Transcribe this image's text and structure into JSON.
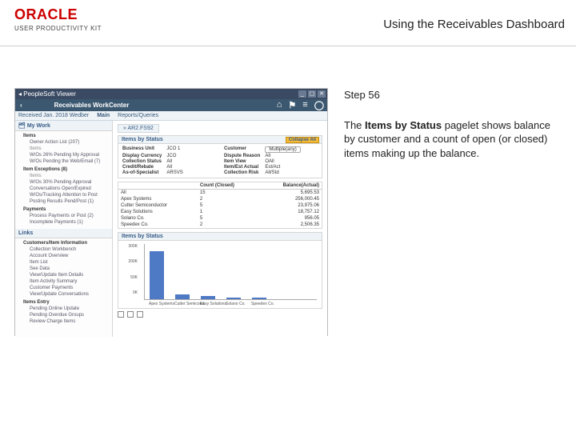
{
  "header": {
    "brand": "ORACLE",
    "brand_sub": "USER PRODUCTIVITY KIT",
    "lesson_title": "Using the Receivables Dashboard"
  },
  "instruction": {
    "step_label": "Step 56",
    "text_pre": "The ",
    "text_bold": "Items by Status",
    "text_post": " pagelet shows balance by customer and a count of open (or closed) items making up the balance."
  },
  "titlebar": {
    "caption": "◂ PeopleSoft Viewer"
  },
  "appbar": {
    "back": "‹",
    "title": "Receivables WorkCenter",
    "icons": [
      "⌂",
      "⚑",
      "≡",
      "◯"
    ]
  },
  "navrow": {
    "left": "Received Jan. 2018 Wedber",
    "items": [
      "Main",
      "Reports/Queries"
    ]
  },
  "leftnav": {
    "mywork_hdr": "My Work",
    "items_hdr": "Items",
    "items": [
      "Owner Action List (207)",
      "Items",
      "W/Os 26% Pending My Approval",
      "W/Os Pending the Web/Email (7)"
    ],
    "exceptions_hdr": "Item Exceptions (8)",
    "exceptions": [
      "Items",
      "W/Os 30% Pending Approval",
      "Conversations Open/Expired",
      "W/Os/Tracking Attention to Post",
      "Posting Results Pend/Post (1)"
    ],
    "payments_hdr": "Payments",
    "payments": [
      "Process Payments or Post (2)",
      "Incomplete Payments (1)"
    ],
    "links_hdr": "Links",
    "links_section": "Customers/Item Information",
    "links": [
      "Collection Workbench",
      "Account Overview",
      "Item List",
      "See Data",
      "View/Update Item Details",
      "Item Activity Summary",
      "Customer Payments",
      "View/Update Conversations"
    ],
    "items_entry_hdr": "Items Entry",
    "items_entry": [
      "Pending Online Update",
      "Pending Overdue Groups",
      "Review Charge Items"
    ]
  },
  "main": {
    "crumb": "» AR2.FS92",
    "pagelet_title": "Items by Status",
    "collapse_btn": "Collapse All",
    "info": {
      "bu_k": "Business Unit",
      "bu_v": "JCO 1",
      "cust_k": "Customer",
      "cust_v": "Multiple(any)",
      "dc_k": "Display Currency",
      "dc_v": "JCO",
      "dr_k": "Dispute Reason",
      "dr_v": "All",
      "cs_k": "Collection Status",
      "cs_v": "All",
      "iv_k": "Item View",
      "iv_v": "OAll",
      "cr_k": "Credit/Rebate",
      "cr_v": "All",
      "ia_k": "Item/Est Actual",
      "ia_v": "Est/Act",
      "as_k": "As-of-Specialist",
      "as_v": "ARSVS",
      "cc_k": "Collection Risk",
      "cc_v": "All/Std"
    },
    "table": {
      "cols": [
        "",
        "Count (Closed)",
        "Balance(Actual)"
      ],
      "rows": [
        [
          "All",
          "15",
          "5,695.53"
        ],
        [
          "Apex Systems",
          "2",
          "256,000.45"
        ],
        [
          "Cutter Semiconductor",
          "5",
          "23,975.06"
        ],
        [
          "Easy Solutions",
          "1",
          "18,757.12"
        ],
        [
          "Solano Co.",
          "5",
          "956.05"
        ],
        [
          "Speedex Co.",
          "2",
          "2,506.35"
        ]
      ]
    },
    "chart_title": "Items by Status"
  },
  "chart_data": {
    "type": "bar",
    "title": "Items by Status",
    "xlabel": "",
    "ylabel": "",
    "yticks": [
      "300K",
      "—",
      "200K",
      "—",
      "50K",
      "0K"
    ],
    "ylim": [
      0,
      300000
    ],
    "categories": [
      "Apex Systems",
      "Cutter Semicond.",
      "Easy Solutions",
      "Solano Co.",
      "Speedex Co."
    ],
    "values": [
      256000,
      23975,
      18757,
      956,
      2506
    ]
  }
}
